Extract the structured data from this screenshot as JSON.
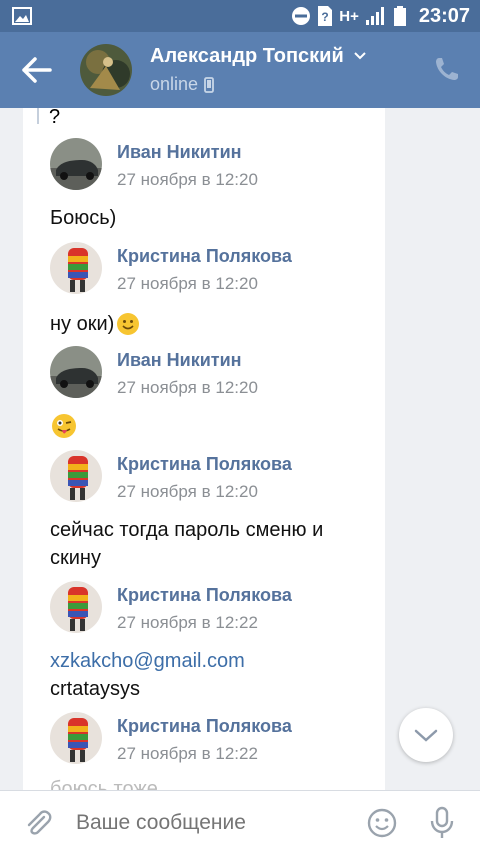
{
  "status_bar": {
    "network": "H+",
    "time": "23:07"
  },
  "header": {
    "name": "Александр Топский",
    "status": "online"
  },
  "quote_fragment": "?",
  "messages": [
    {
      "author": "Иван Никитин",
      "time": "27 ноября в 12:20",
      "text": "Боюсь)",
      "avatar": "car"
    },
    {
      "author": "Кристина Полякова",
      "time": "27 ноября в 12:20",
      "text": "ну оки)",
      "avatar": "girl"
    },
    {
      "author": "Иван Никитин",
      "time": "27 ноября в 12:20",
      "text": "",
      "avatar": "car"
    },
    {
      "author": "Кристина Полякова",
      "time": "27 ноября в 12:20",
      "text": "сейчас тогда пароль сменю и скину",
      "avatar": "girl"
    },
    {
      "author": "Кристина Полякова",
      "time": "27 ноября в 12:22",
      "link": "xzkakcho@gmail.com",
      "text": "crtataysys",
      "avatar": "girl"
    },
    {
      "author": "Кристина Полякова",
      "time": "27 ноября в 12:22",
      "text": "",
      "avatar": "girl"
    }
  ],
  "faded_text": "боюсь тоже",
  "composer": {
    "placeholder": "Ваше сообщение"
  }
}
